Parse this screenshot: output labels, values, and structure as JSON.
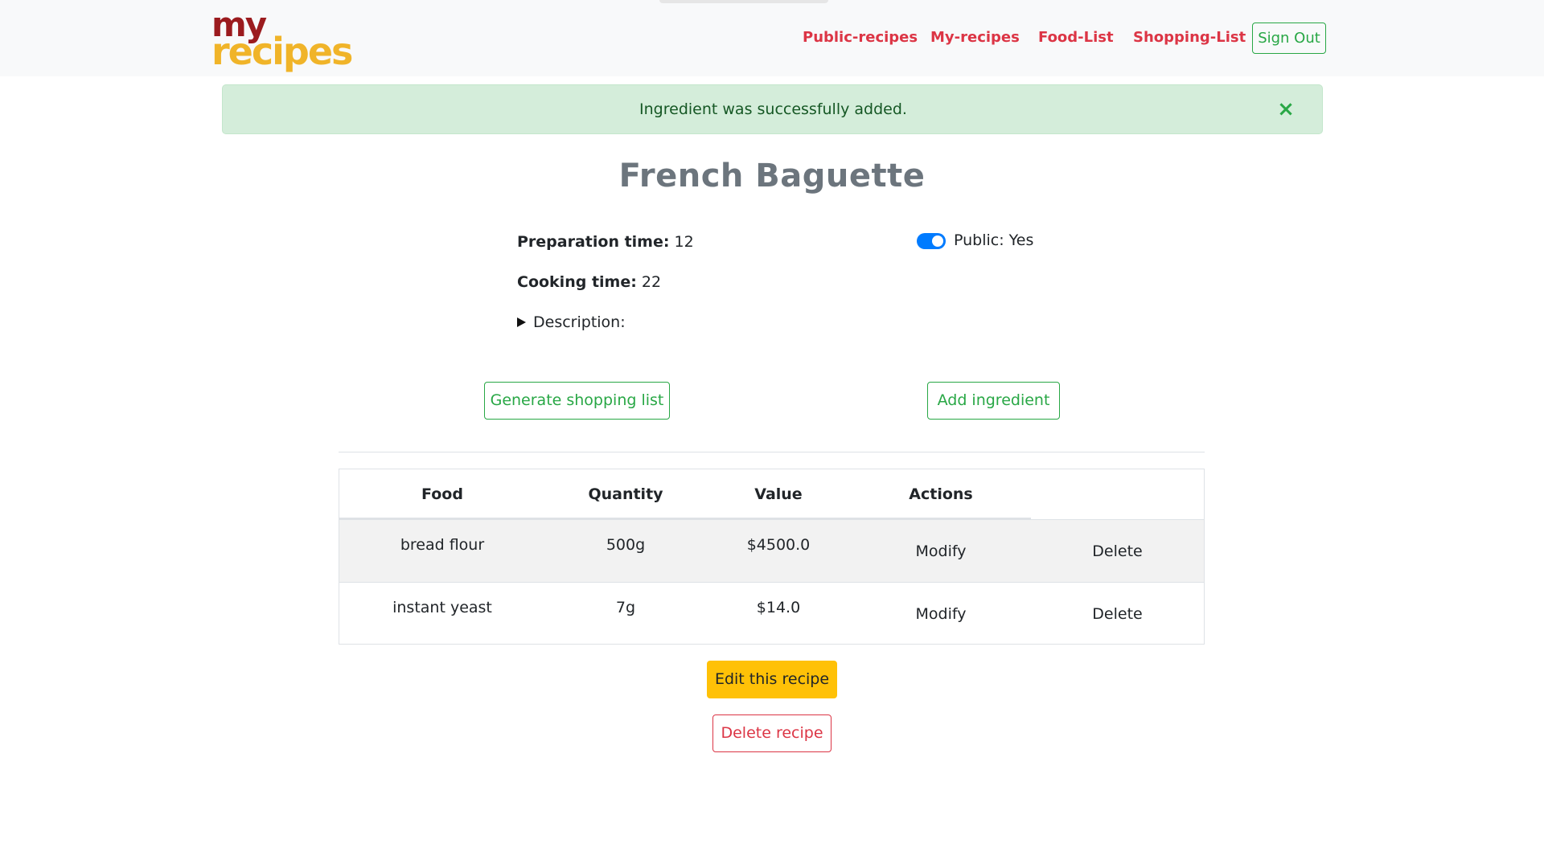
{
  "brand": {
    "logo_top": "my",
    "logo_bottom": "recipes"
  },
  "nav": {
    "links": [
      "Public-recipes",
      "My-recipes",
      "Food-List",
      "Shopping-List"
    ],
    "signout_label": "Sign Out"
  },
  "alert": {
    "message": "Ingredient was successfully added.",
    "close_symbol": "×"
  },
  "recipe": {
    "title": "French Baguette",
    "prep_label": "Preparation time:",
    "prep_value": "12",
    "cook_label": "Cooking time:",
    "cook_value": "22",
    "description_label": "Description:",
    "public_label": "Public: Yes",
    "public_on": true
  },
  "actions": {
    "generate_label": "Generate shopping list",
    "add_ingredient_label": "Add ingredient"
  },
  "table": {
    "headers": [
      "Food",
      "Quantity",
      "Value",
      "Actions"
    ],
    "rows": [
      {
        "food": "bread flour",
        "quantity": "500g",
        "value": "$4500.0",
        "modify": "Modify",
        "delete": "Delete"
      },
      {
        "food": "instant yeast",
        "quantity": "7g",
        "value": "$14.0",
        "modify": "Modify",
        "delete": "Delete"
      }
    ]
  },
  "footer_actions": {
    "edit_label": "Edit this recipe",
    "delete_label": "Delete recipe"
  },
  "colors": {
    "nav_link": "#dc3545",
    "success": "#28a745",
    "warning": "#ffc107",
    "switch_on": "#007bff",
    "logo_red": "#9b1b1e",
    "logo_yellow": "#f0b429"
  }
}
